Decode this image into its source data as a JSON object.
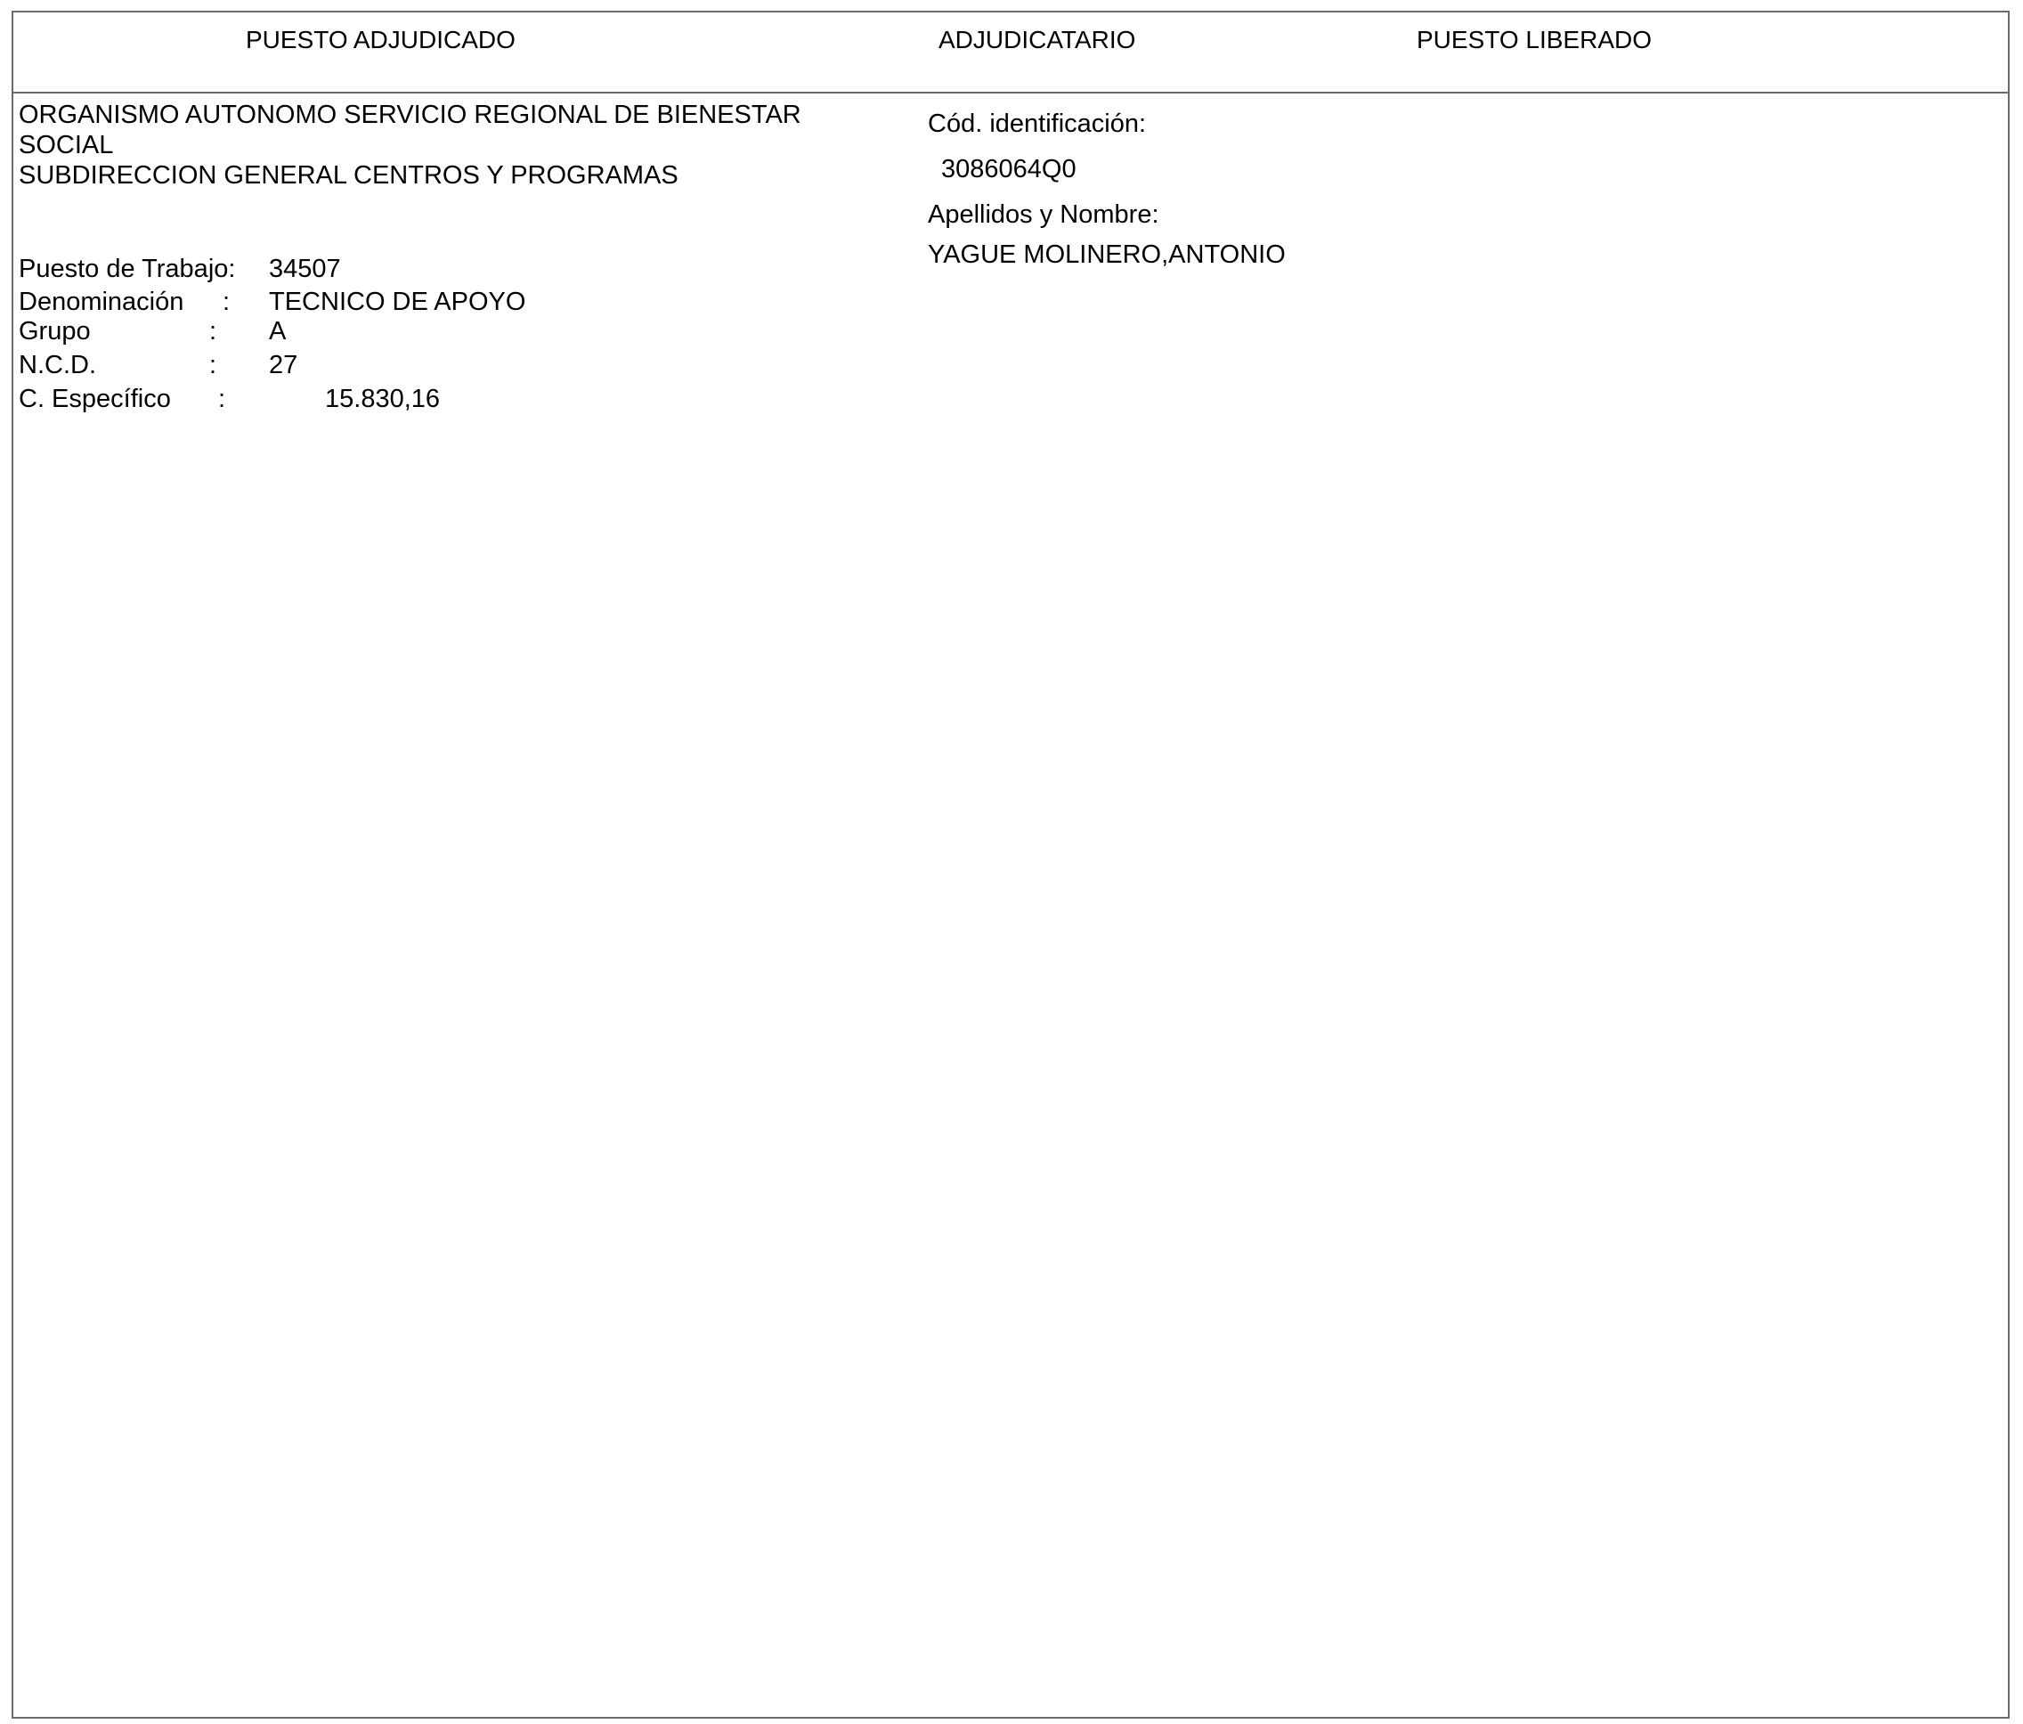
{
  "header": {
    "puesto_adjudicado": "PUESTO ADJUDICADO",
    "adjudicatario": "ADJUDICATARIO",
    "puesto_liberado": "PUESTO LIBERADO"
  },
  "organismo": {
    "line1": "ORGANISMO AUTONOMO SERVICIO REGIONAL DE BIENESTAR",
    "line2": "SOCIAL",
    "line3": "SUBDIRECCION GENERAL CENTROS Y PROGRAMAS"
  },
  "puesto": {
    "trabajo_label": "Puesto de Trabajo:",
    "trabajo_value": "34507",
    "denominacion_label": "Denominación",
    "denominacion_colon": ":",
    "denominacion_value": "TECNICO DE APOYO",
    "grupo_label": "Grupo",
    "grupo_colon": ":",
    "grupo_value": "A",
    "ncd_label": "N.C.D.",
    "ncd_colon": ":",
    "ncd_value": "27",
    "especifico_label": "C. Específico",
    "especifico_colon": ":",
    "especifico_value": "15.830,16"
  },
  "adjudicatario": {
    "cod_label": "Cód. identificación:",
    "cod_value": "3086064Q0",
    "nombre_label": "Apellidos y Nombre:",
    "nombre_value": "YAGUE MOLINERO,ANTONIO"
  }
}
